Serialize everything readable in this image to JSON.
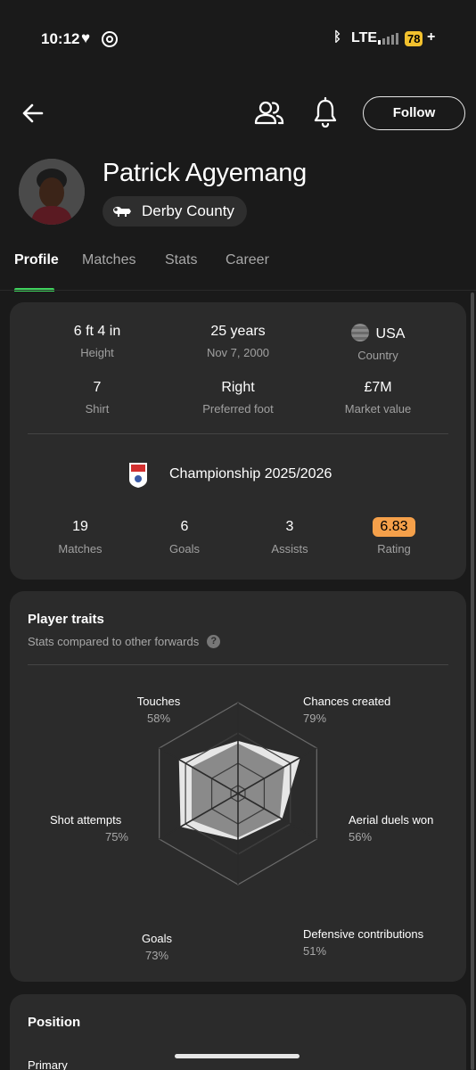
{
  "status_bar": {
    "time": "10:12",
    "network": "LTE",
    "battery": "78",
    "battery_charging": "+"
  },
  "header": {
    "follow_label": "Follow",
    "player_name": "Patrick Agyemang",
    "team_name": "Derby County"
  },
  "tabs": [
    {
      "label": "Profile",
      "active": true
    },
    {
      "label": "Matches",
      "active": false
    },
    {
      "label": "Stats",
      "active": false
    },
    {
      "label": "Career",
      "active": false
    }
  ],
  "info": {
    "height": {
      "value": "6 ft 4 in",
      "label": "Height"
    },
    "age": {
      "value": "25 years",
      "label": "Nov 7, 2000"
    },
    "country": {
      "value": "USA",
      "label": "Country"
    },
    "shirt": {
      "value": "7",
      "label": "Shirt"
    },
    "foot": {
      "value": "Right",
      "label": "Preferred foot"
    },
    "market": {
      "value": "£7M",
      "label": "Market value"
    }
  },
  "league": {
    "name": "Championship 2025/2026",
    "stats": [
      {
        "value": "19",
        "label": "Matches"
      },
      {
        "value": "6",
        "label": "Goals"
      },
      {
        "value": "3",
        "label": "Assists"
      },
      {
        "value": "6.83",
        "label": "Rating"
      }
    ],
    "rating_color": "#f5a04a"
  },
  "traits": {
    "title": "Player traits",
    "subtitle": "Stats compared to other forwards",
    "items": [
      {
        "label": "Touches",
        "percent": "58%",
        "value": 58
      },
      {
        "label": "Chances created",
        "percent": "79%",
        "value": 79
      },
      {
        "label": "Aerial duels won",
        "percent": "56%",
        "value": 56
      },
      {
        "label": "Defensive contributions",
        "percent": "51%",
        "value": 51
      },
      {
        "label": "Goals",
        "percent": "73%",
        "value": 73
      },
      {
        "label": "Shot attempts",
        "percent": "75%",
        "value": 75
      }
    ]
  },
  "position": {
    "title": "Position",
    "sub_label": "Primary"
  },
  "colors": {
    "accent": "#3fd55e",
    "background": "#1a1a1a",
    "card": "#2b2b2b"
  }
}
